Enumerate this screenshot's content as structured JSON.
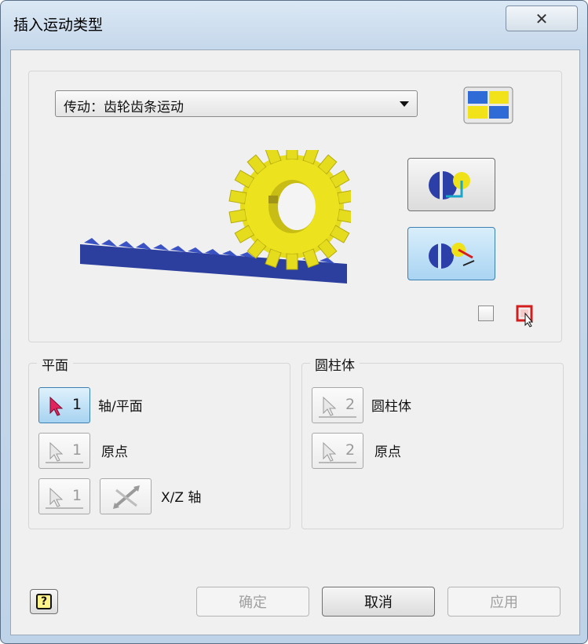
{
  "window": {
    "title": "插入运动类型",
    "close_glyph": "✕"
  },
  "preview": {
    "motion_type": "传动：齿轮齿条运动",
    "layout_icon": "layout-grid-icon",
    "mode_buttons": [
      {
        "name": "forward-mode",
        "active": false
      },
      {
        "name": "reverse-mode",
        "active": true
      }
    ],
    "checkbox_checked": false
  },
  "plane_group": {
    "title": "平面",
    "rows": [
      {
        "num": "1",
        "label": "轴/平面",
        "active": true
      },
      {
        "num": "1",
        "label": "原点",
        "active": false
      },
      {
        "num": "1",
        "label": "X/Z 轴",
        "active": false
      }
    ]
  },
  "cylinder_group": {
    "title": "圆柱体",
    "rows": [
      {
        "num": "2",
        "label": "圆柱体",
        "active": false
      },
      {
        "num": "2",
        "label": "原点",
        "active": false
      }
    ]
  },
  "footer": {
    "help_glyph": "?",
    "ok_label": "确定",
    "cancel_label": "取消",
    "apply_label": "应用"
  },
  "colors": {
    "gear": "#e6dc1e",
    "rack": "#2c3f9f",
    "accent": "#3c7fb1"
  }
}
